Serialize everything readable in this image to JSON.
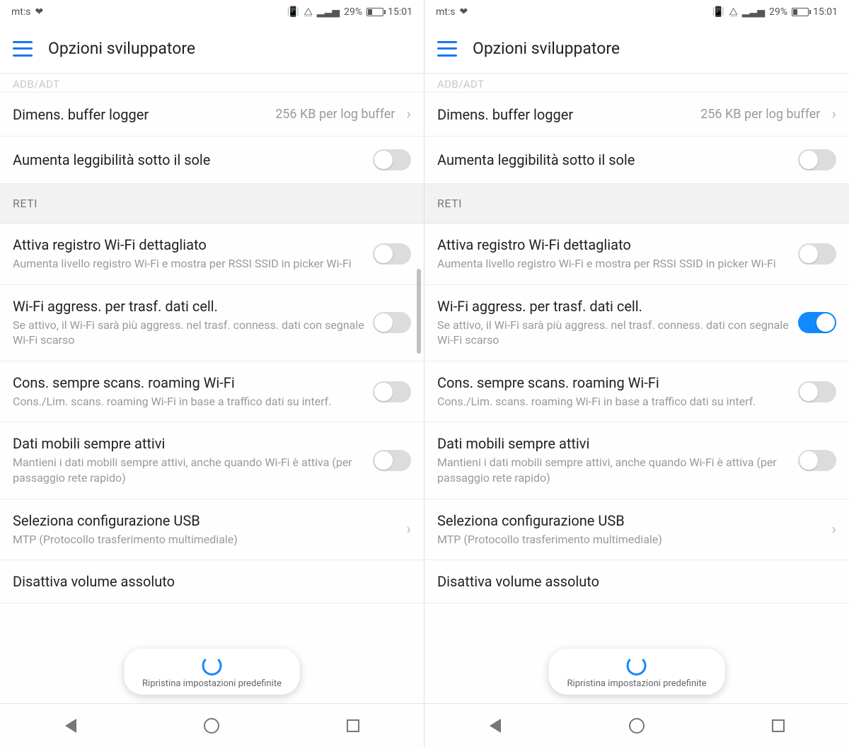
{
  "status": {
    "carrier": "mt:s",
    "battery_percent": "29%",
    "time": "15:01"
  },
  "header": {
    "title": "Opzioni sviluppatore"
  },
  "ghost_section": "ADB/ADT",
  "rows": {
    "buffer": {
      "title": "Dimens. buffer logger",
      "value": "256 KB per log buffer"
    },
    "sunlight": {
      "title": "Aumenta leggibilità sotto il sole"
    },
    "section_net": "RETI",
    "wifi_log": {
      "title": "Attiva registro Wi-Fi dettagliato",
      "sub": "Aumenta livello registro Wi-Fi e mostra per RSSI SSID in picker Wi-Fi"
    },
    "wifi_aggr": {
      "title": "Wi-Fi aggress. per trasf. dati cell.",
      "sub": "Se attivo, il Wi-Fi sarà più aggress. nel trasf. conness. dati con segnale Wi-Fi scarso"
    },
    "wifi_roam": {
      "title": "Cons. sempre scans. roaming Wi-Fi",
      "sub": "Cons./Lim. scans. roaming Wi-Fi in base a traffico dati su interf."
    },
    "mobile_data": {
      "title": "Dati mobili sempre attivi",
      "sub": "Mantieni i dati mobili sempre attivi, anche quando Wi-Fi è attiva (per passaggio rete rapido)"
    },
    "usb": {
      "title": "Seleziona configurazione USB",
      "sub": "MTP (Protocollo trasferimento multimediale)"
    },
    "abs_vol": {
      "title": "Disattiva volume assoluto"
    }
  },
  "reset_pill": "Ripristina impostazioni predefinite",
  "screens": [
    {
      "wifi_aggr_on": false,
      "show_scroll_hint": true
    },
    {
      "wifi_aggr_on": true,
      "show_scroll_hint": false
    }
  ]
}
